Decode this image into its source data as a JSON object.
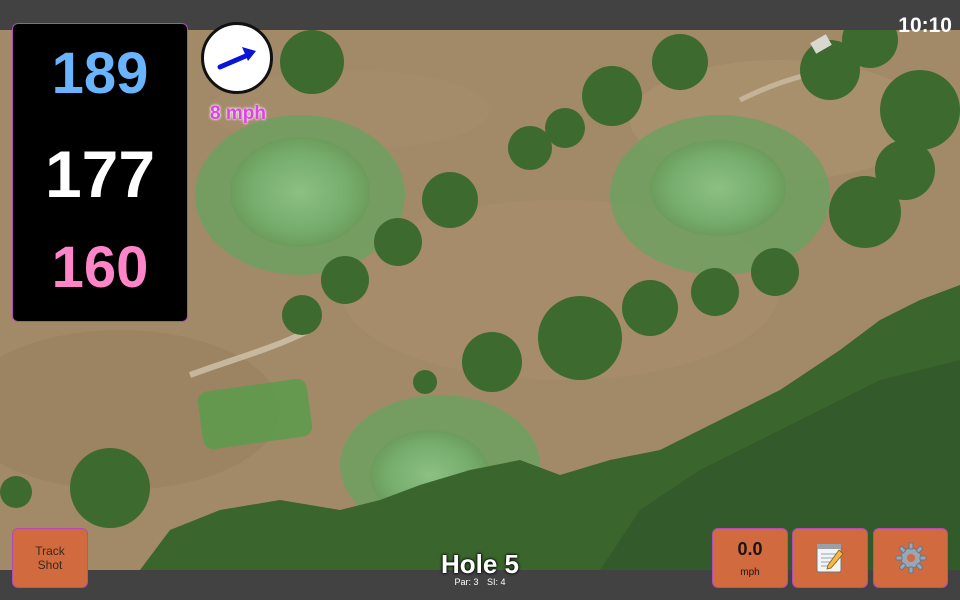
{
  "status": {
    "clock": "10:10"
  },
  "distances": {
    "back": "189",
    "middle": "177",
    "front": "160",
    "back_color": "#6ab4ff",
    "middle_color": "#ffffff",
    "front_color": "#ff85c8"
  },
  "wind": {
    "speed": "8 mph",
    "arrow_color": "#0a14d8",
    "speed_color": "#e040e8"
  },
  "hole": {
    "title": "Hole 5",
    "par": "Par: 3",
    "si": "SI: 4"
  },
  "buttons": {
    "track_shot_line1": "Track",
    "track_shot_line2": "Shot",
    "speed_value": "0.0",
    "speed_unit": "mph",
    "notes_icon": "notepad-icon",
    "settings_icon": "gear-icon"
  },
  "colors": {
    "button_bg": "#d16a3e",
    "bar_bg": "#424242",
    "accent_border": "#b04bb8"
  }
}
